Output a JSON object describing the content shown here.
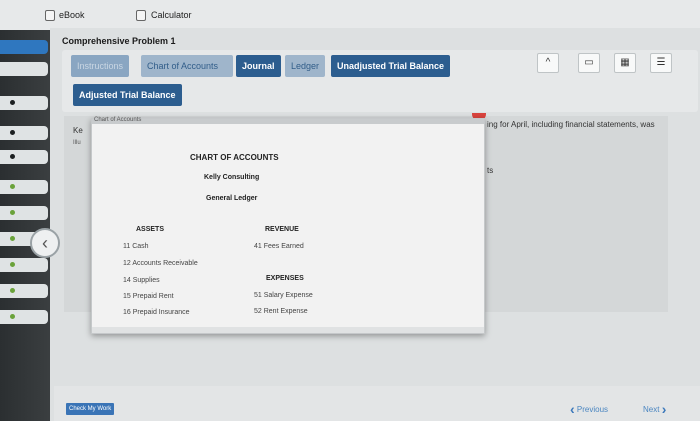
{
  "topbar": {
    "ebook_label": "eBook",
    "calculator_label": "Calculator"
  },
  "problem_title": "Comprehensive Problem 1",
  "tabs": [
    {
      "label": "Instructions"
    },
    {
      "label": "Chart of Accounts"
    },
    {
      "label": "Journal"
    },
    {
      "label": "Ledger"
    },
    {
      "label": "Unadjusted Trial Balance"
    },
    {
      "label": "Adjusted Trial Balance"
    }
  ],
  "right_icons": [
    "chevron-up-icon",
    "window-icon",
    "grid-icon",
    "list-icon"
  ],
  "background_text": {
    "ke": "Ke",
    "ill": "Illu",
    "side_text": "ing for April, including financial statements, was",
    "side_text2": "ts"
  },
  "popup": {
    "header": "Chart of Accounts",
    "title": "CHART OF ACCOUNTS",
    "company": "Kelly Consulting",
    "ledger": "General Ledger",
    "assets_heading": "ASSETS",
    "assets": [
      "11 Cash",
      "12 Accounts Receivable",
      "14 Supplies",
      "15 Prepaid Rent",
      "16 Prepaid Insurance"
    ],
    "revenue_heading": "REVENUE",
    "revenue": [
      "41 Fees Earned"
    ],
    "expenses_heading": "EXPENSES",
    "expenses": [
      "51 Salary Expense",
      "52 Rent Expense"
    ]
  },
  "footer": {
    "check_label": "Check My Work",
    "previous_label": "Previous",
    "next_label": "Next"
  },
  "colors": {
    "accent": "#2c5d8f",
    "link": "#4b86c1"
  }
}
